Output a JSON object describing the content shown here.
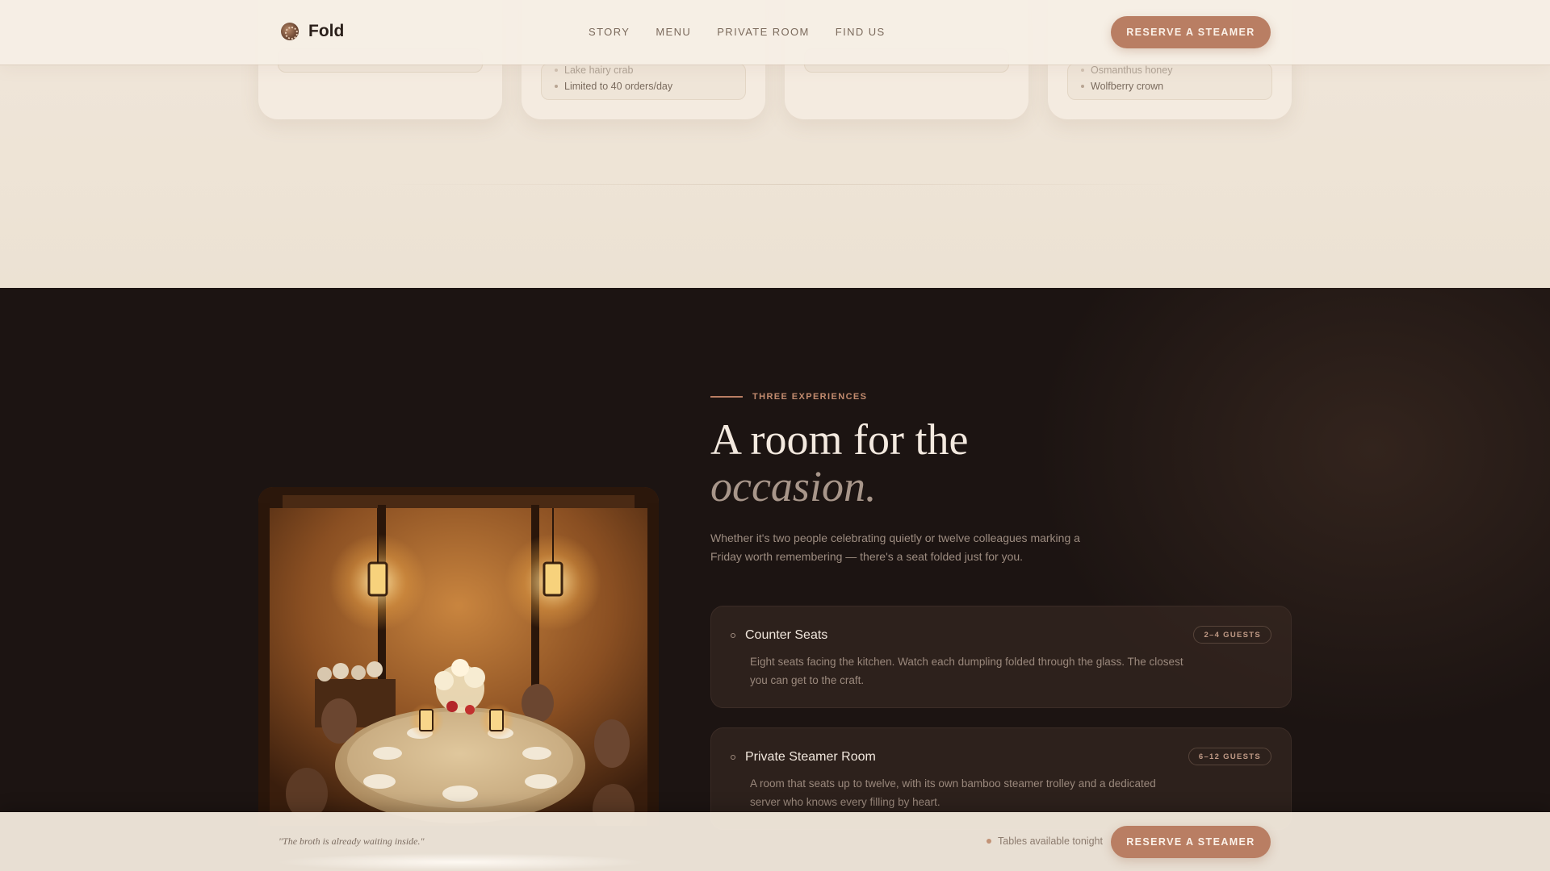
{
  "header": {
    "brand": "Fold",
    "nav": [
      "STORY",
      "MENU",
      "PRIVATE ROOM",
      "FIND US"
    ],
    "cta": "RESERVE A STEAMER"
  },
  "menu_cards": [
    {
      "features": []
    },
    {
      "features": [
        "Lake hairy crab",
        "Limited to 40 orders/day"
      ]
    },
    {
      "features": []
    },
    {
      "features": [
        "Osmanthus honey",
        "Wolfberry crown"
      ]
    }
  ],
  "experiences": {
    "eyebrow": "THREE EXPERIENCES",
    "headline_main": "A room for the",
    "headline_em": "occasion.",
    "lede": "Whether it's two people celebrating quietly or twelve colleagues marking a Friday worth remembering — there's a seat folded just for you.",
    "items": [
      {
        "title": "Counter Seats",
        "badge": "2–4 GUESTS",
        "desc": "Eight seats facing the kitchen. Watch each dumpling folded through the glass. The closest you can get to the craft."
      },
      {
        "title": "Private Steamer Room",
        "badge": "6–12 GUESTS",
        "desc": "A room that seats up to twelve, with its own bamboo steamer trolley and a dedicated server who knows every filling by heart."
      }
    ]
  },
  "bottom_bar": {
    "quote": "\"The broth is already waiting inside.\"",
    "availability": "Tables available tonight",
    "cta": "RESERVE A STEAMER"
  },
  "colors": {
    "accent": "#b97e63",
    "dark_bg": "#1c1412",
    "light_bg": "#efe4d6"
  }
}
